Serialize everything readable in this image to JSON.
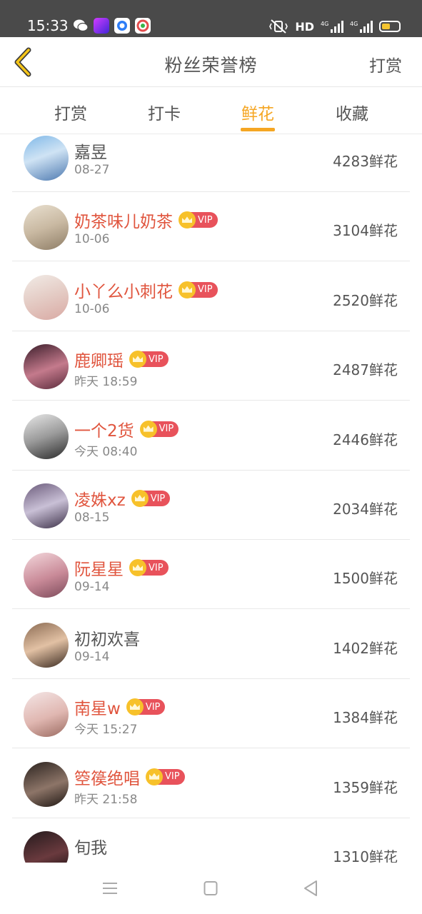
{
  "status_bar": {
    "time": "15:33",
    "network_label": "HD",
    "icons": [
      "wechat-icon",
      "video-player-icon",
      "circle-app-icon",
      "browser-icon",
      "mute-vibrate-icon",
      "hd-icon",
      "signal-4g-icon",
      "signal-4g-icon",
      "battery-icon"
    ],
    "battery_color": "#f4c531"
  },
  "header": {
    "title": "粉丝荣誉榜",
    "action_label": "打赏",
    "back_icon": "chevron-left-icon",
    "accent_color": "#f5a623"
  },
  "tabs": [
    {
      "label": "打赏",
      "active": false
    },
    {
      "label": "打卡",
      "active": false
    },
    {
      "label": "鲜花",
      "active": true
    },
    {
      "label": "收藏",
      "active": false
    }
  ],
  "fans": [
    {
      "name": "嘉昱",
      "date": "08-27",
      "count": "4283鲜花",
      "vip": false
    },
    {
      "name": "奶茶味儿奶茶",
      "date": "10-06",
      "count": "3104鲜花",
      "vip": true
    },
    {
      "name": "小丫么小刺花",
      "date": "10-06",
      "count": "2520鲜花",
      "vip": true
    },
    {
      "name": "鹿卿瑶",
      "date": "昨天 18:59",
      "count": "2487鲜花",
      "vip": true
    },
    {
      "name": "一个2货",
      "date": "今天 08:40",
      "count": "2446鲜花",
      "vip": true
    },
    {
      "name": "凌姝xz",
      "date": "08-15",
      "count": "2034鲜花",
      "vip": true
    },
    {
      "name": "阮星星",
      "date": "09-14",
      "count": "1500鲜花",
      "vip": true
    },
    {
      "name": "初初欢喜",
      "date": "09-14",
      "count": "1402鲜花",
      "vip": false
    },
    {
      "name": "南星w",
      "date": "今天 15:27",
      "count": "1384鲜花",
      "vip": true
    },
    {
      "name": "箜篌绝唱",
      "date": "昨天 21:58",
      "count": "1359鲜花",
      "vip": true
    },
    {
      "name": "旬我",
      "date": "",
      "count": "1310鲜花",
      "vip": false
    }
  ],
  "vip_badge_label": "VIP",
  "vip_colors": {
    "name": "#e0553e",
    "badge": "#e8525b",
    "crown": "#f7c12a"
  },
  "nav_bar": {
    "icons": [
      "menu-icon",
      "home-square-icon",
      "back-triangle-icon"
    ]
  }
}
